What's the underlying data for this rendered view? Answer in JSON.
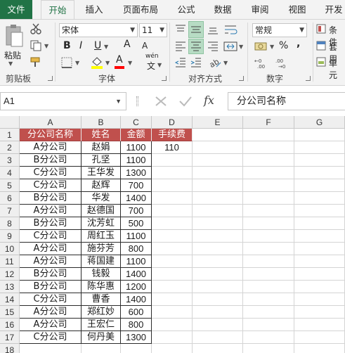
{
  "tabs": [
    "文件",
    "开始",
    "插入",
    "页面布局",
    "公式",
    "数据",
    "审阅",
    "视图",
    "开发"
  ],
  "ribbon": {
    "paste_label": "粘贴",
    "clipboard_label": "剪贴板",
    "font_name": "宋体",
    "font_size": "11",
    "bold": "B",
    "italic": "I",
    "underline": "U",
    "grow_font": "A",
    "shrink_font": "A",
    "font_color_glyph": "A",
    "phonetic_top": "wén",
    "phonetic_bottom": "文",
    "font_label": "字体",
    "align_label": "对齐方式",
    "number_format": "常规",
    "percent": "%",
    "comma": ",",
    "number_label": "数字",
    "cond_format": "条件",
    "table_format": "套用",
    "cell_style": "单元",
    "highlight_color": "#ffff00",
    "font_color": "#ff0000",
    "accent": "#217346"
  },
  "formula_bar": {
    "name_box": "A1",
    "fx": "fx",
    "content": "分公司名称"
  },
  "columns": [
    "A",
    "B",
    "C",
    "D",
    "E",
    "F",
    "G"
  ],
  "rows": [
    "1",
    "2",
    "3",
    "4",
    "5",
    "6",
    "7",
    "8",
    "9",
    "10",
    "11",
    "12",
    "13",
    "14",
    "15",
    "16",
    "17",
    "18"
  ],
  "headers": [
    "分公司名称",
    "姓名",
    "金额",
    "手续费"
  ],
  "data": [
    [
      "A分公司",
      "赵娟",
      "1100"
    ],
    [
      "B分公司",
      "孔坚",
      "1100"
    ],
    [
      "C分公司",
      "王华发",
      "1300"
    ],
    [
      "C分公司",
      "赵辉",
      "700"
    ],
    [
      "B分公司",
      "华发",
      "1400"
    ],
    [
      "A分公司",
      "赵德国",
      "700"
    ],
    [
      "B分公司",
      "沈芳虹",
      "500"
    ],
    [
      "C分公司",
      "周红玉",
      "1100"
    ],
    [
      "A分公司",
      "施芬芳",
      "800"
    ],
    [
      "A分公司",
      "蒋国建",
      "1100"
    ],
    [
      "B分公司",
      "钱毅",
      "1400"
    ],
    [
      "B分公司",
      "陈华惠",
      "1200"
    ],
    [
      "C分公司",
      "曹香",
      "1400"
    ],
    [
      "A分公司",
      "郑红妙",
      "600"
    ],
    [
      "A分公司",
      "王宏仁",
      "800"
    ],
    [
      "C分公司",
      "何丹美",
      "1300"
    ]
  ],
  "d2_value": "110",
  "header_fill": "#c0504d"
}
